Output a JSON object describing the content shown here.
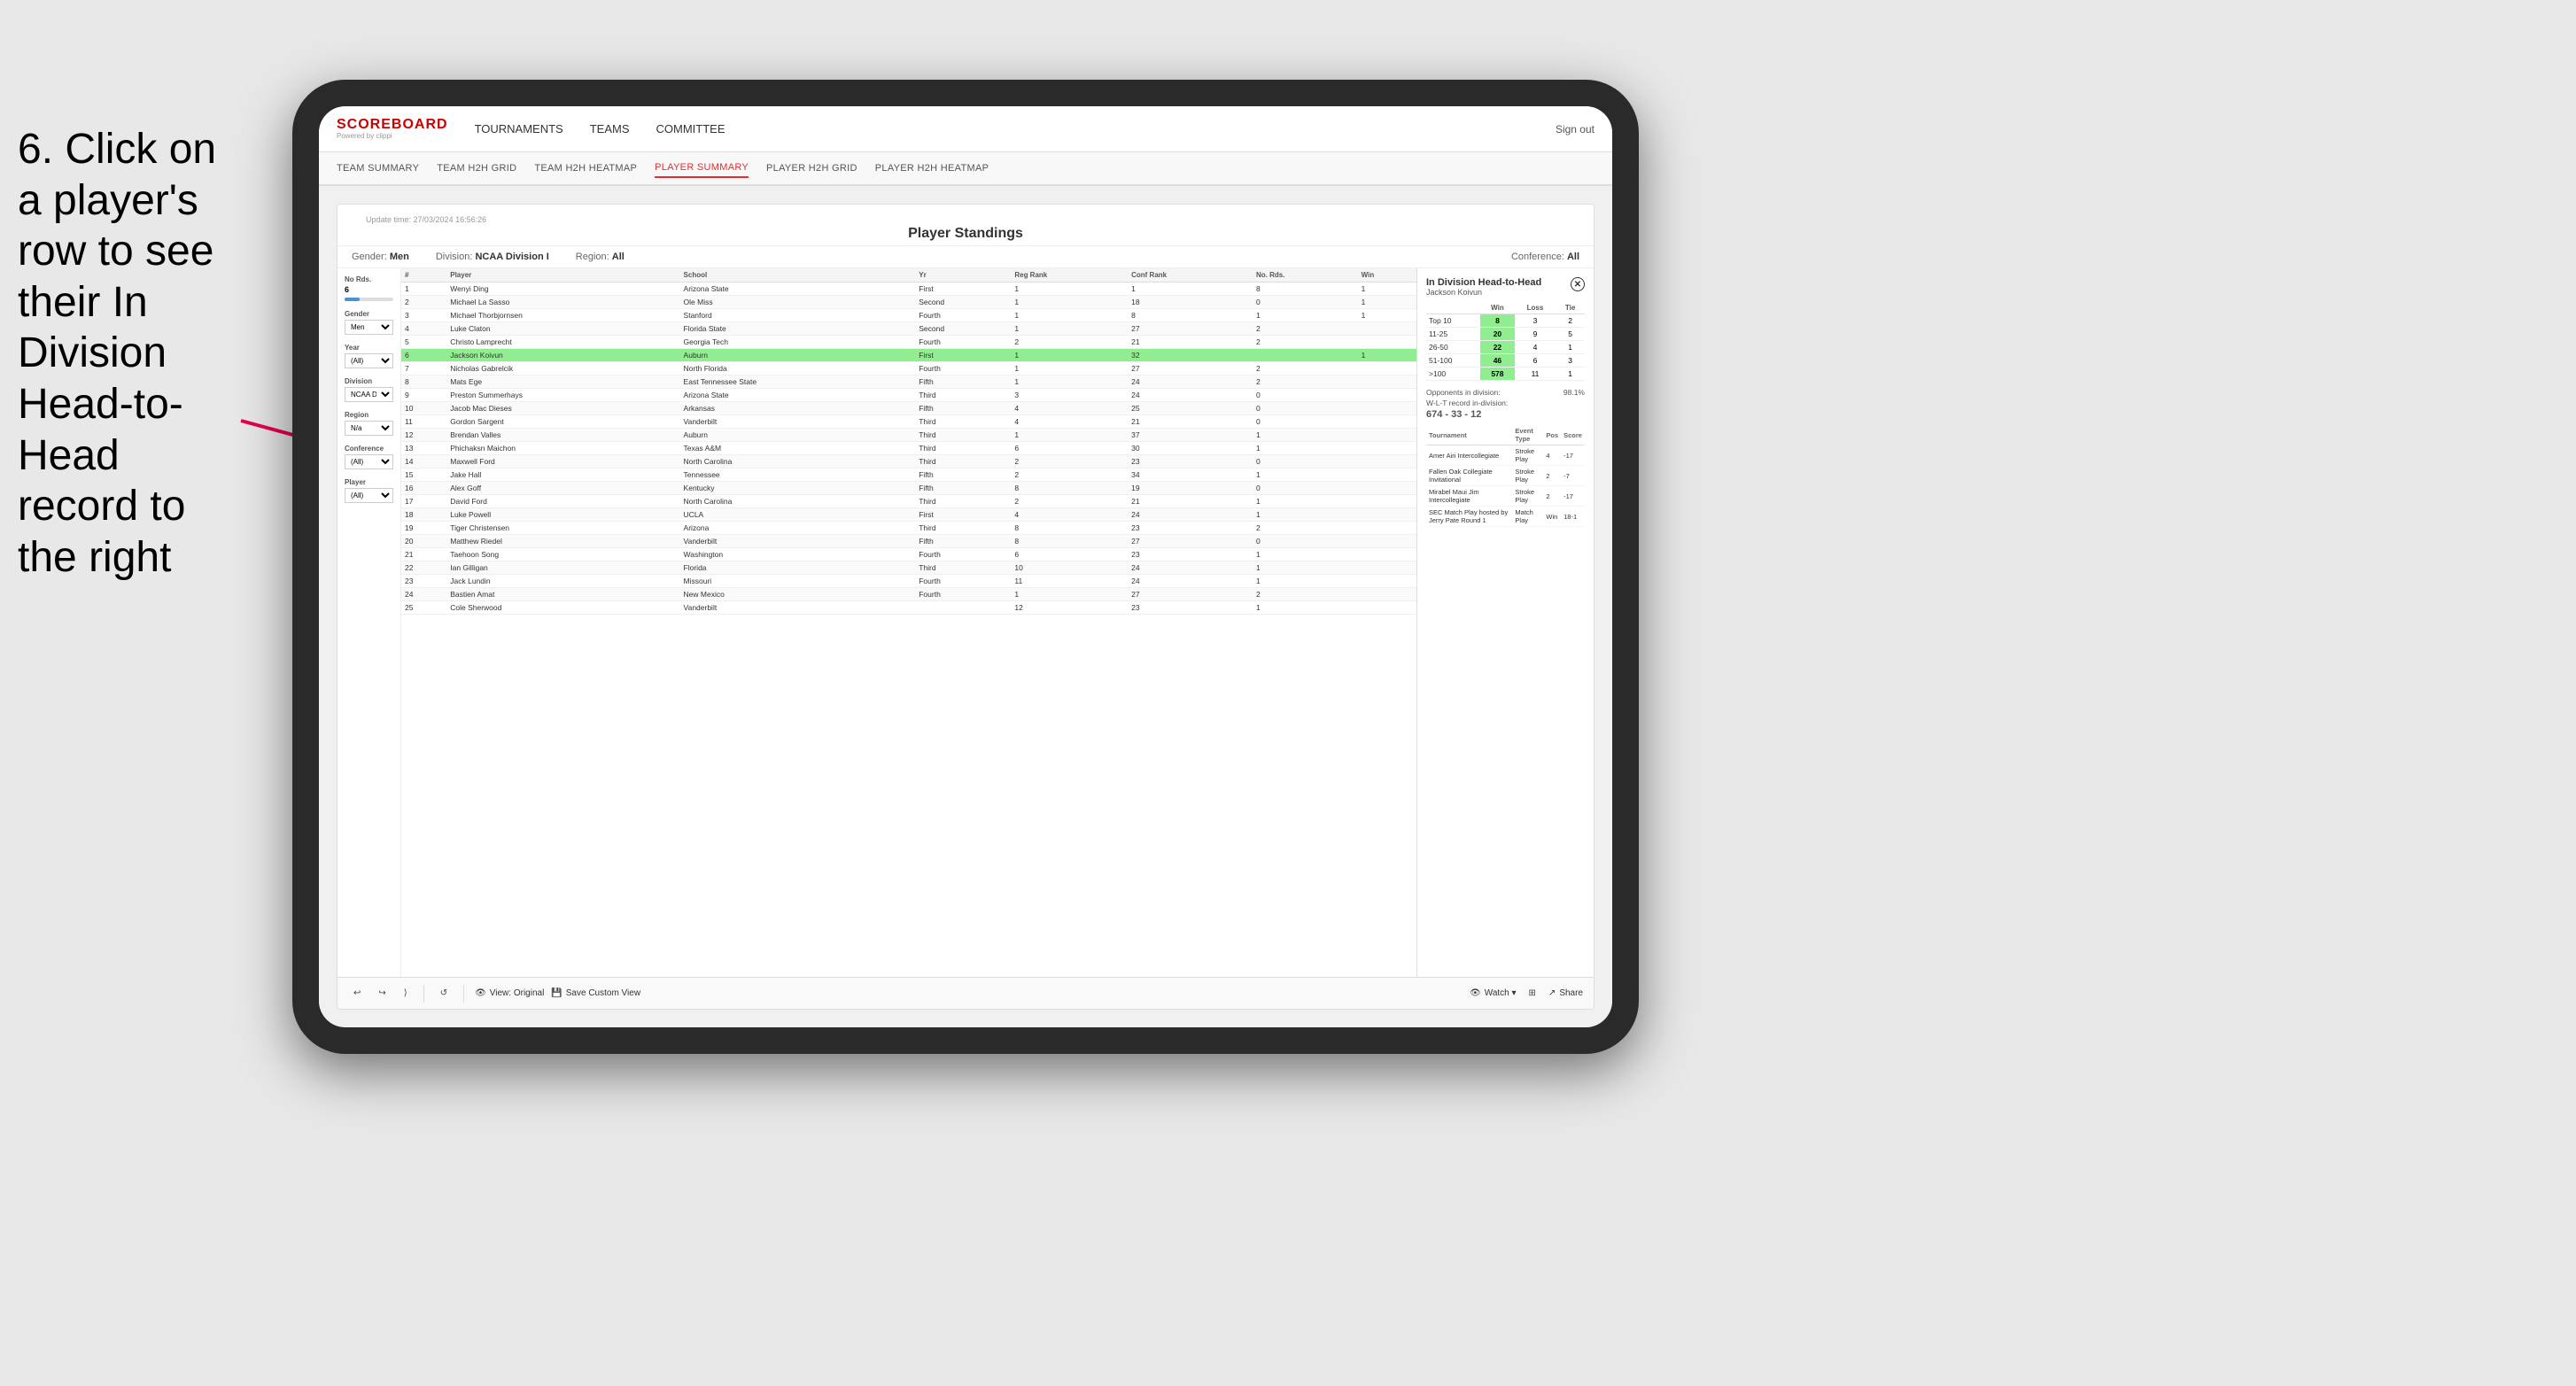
{
  "instruction": {
    "text": "6. Click on a player's row to see their In Division Head-to-Head record to the right"
  },
  "nav": {
    "logo": "SCOREBOARD",
    "powered_by": "Powered by clippi",
    "items": [
      "TOURNAMENTS",
      "TEAMS",
      "COMMITTEE"
    ],
    "sign_out": "Sign out"
  },
  "sub_nav": {
    "items": [
      "TEAM SUMMARY",
      "TEAM H2H GRID",
      "TEAM H2H HEATMAP",
      "PLAYER SUMMARY",
      "PLAYER H2H GRID",
      "PLAYER H2H HEATMAP"
    ],
    "active": "PLAYER SUMMARY"
  },
  "dashboard": {
    "update_time": "Update time: 27/03/2024 16:56:26",
    "title": "Player Standings",
    "filters": {
      "gender_label": "Gender:",
      "gender_value": "Men",
      "division_label": "Division:",
      "division_value": "NCAA Division I",
      "region_label": "Region:",
      "region_value": "All",
      "conference_label": "Conference:",
      "conference_value": "All"
    },
    "sidebar": {
      "no_rds_label": "No Rds.",
      "no_rds_value": "6",
      "gender_label": "Gender",
      "gender_value": "Men",
      "year_label": "Year",
      "year_value": "(All)",
      "division_label": "Division",
      "division_value": "NCAA Division I",
      "region_label": "Region",
      "region_value": "N/a",
      "conference_label": "Conference",
      "conference_value": "(All)",
      "player_label": "Player",
      "player_value": "(All)"
    },
    "table": {
      "columns": [
        "#",
        "Player",
        "School",
        "Yr",
        "Reg Rank",
        "Conf Rank",
        "No. Rds.",
        "Win"
      ],
      "rows": [
        {
          "num": "1",
          "player": "Wenyi Ding",
          "school": "Arizona State",
          "yr": "First",
          "reg_rank": "1",
          "conf_rank": "1",
          "no_rds": "8",
          "win": "1"
        },
        {
          "num": "2",
          "player": "Michael La Sasso",
          "school": "Ole Miss",
          "yr": "Second",
          "reg_rank": "1",
          "conf_rank": "18",
          "no_rds": "0",
          "win": "1"
        },
        {
          "num": "3",
          "player": "Michael Thorbjornsen",
          "school": "Stanford",
          "yr": "Fourth",
          "reg_rank": "1",
          "conf_rank": "8",
          "no_rds": "1",
          "win": "1"
        },
        {
          "num": "4",
          "player": "Luke Claton",
          "school": "Florida State",
          "yr": "Second",
          "reg_rank": "1",
          "conf_rank": "27",
          "no_rds": "2",
          "win": ""
        },
        {
          "num": "5",
          "player": "Christo Lamprecht",
          "school": "Georgia Tech",
          "yr": "Fourth",
          "reg_rank": "2",
          "conf_rank": "21",
          "no_rds": "2",
          "win": ""
        },
        {
          "num": "6",
          "player": "Jackson Koivun",
          "school": "Auburn",
          "yr": "First",
          "reg_rank": "1",
          "conf_rank": "32",
          "no_rds": "",
          "win": "1",
          "highlighted": true
        },
        {
          "num": "7",
          "player": "Nicholas Gabrelcik",
          "school": "North Florida",
          "yr": "Fourth",
          "reg_rank": "1",
          "conf_rank": "27",
          "no_rds": "2",
          "win": ""
        },
        {
          "num": "8",
          "player": "Mats Ege",
          "school": "East Tennessee State",
          "yr": "Fifth",
          "reg_rank": "1",
          "conf_rank": "24",
          "no_rds": "2",
          "win": ""
        },
        {
          "num": "9",
          "player": "Preston Summerhays",
          "school": "Arizona State",
          "yr": "Third",
          "reg_rank": "3",
          "conf_rank": "24",
          "no_rds": "0",
          "win": ""
        },
        {
          "num": "10",
          "player": "Jacob Mac Dieses",
          "school": "Arkansas",
          "yr": "Fifth",
          "reg_rank": "4",
          "conf_rank": "25",
          "no_rds": "0",
          "win": ""
        },
        {
          "num": "11",
          "player": "Gordon Sargent",
          "school": "Vanderbilt",
          "yr": "Third",
          "reg_rank": "4",
          "conf_rank": "21",
          "no_rds": "0",
          "win": ""
        },
        {
          "num": "12",
          "player": "Brendan Valles",
          "school": "Auburn",
          "yr": "Third",
          "reg_rank": "1",
          "conf_rank": "37",
          "no_rds": "1",
          "win": ""
        },
        {
          "num": "13",
          "player": "Phichaksn Maichon",
          "school": "Texas A&M",
          "yr": "Third",
          "reg_rank": "6",
          "conf_rank": "30",
          "no_rds": "1",
          "win": ""
        },
        {
          "num": "14",
          "player": "Maxwell Ford",
          "school": "North Carolina",
          "yr": "Third",
          "reg_rank": "2",
          "conf_rank": "23",
          "no_rds": "0",
          "win": ""
        },
        {
          "num": "15",
          "player": "Jake Hall",
          "school": "Tennessee",
          "yr": "Fifth",
          "reg_rank": "2",
          "conf_rank": "34",
          "no_rds": "1",
          "win": ""
        },
        {
          "num": "16",
          "player": "Alex Goff",
          "school": "Kentucky",
          "yr": "Fifth",
          "reg_rank": "8",
          "conf_rank": "19",
          "no_rds": "0",
          "win": ""
        },
        {
          "num": "17",
          "player": "David Ford",
          "school": "North Carolina",
          "yr": "Third",
          "reg_rank": "2",
          "conf_rank": "21",
          "no_rds": "1",
          "win": ""
        },
        {
          "num": "18",
          "player": "Luke Powell",
          "school": "UCLA",
          "yr": "First",
          "reg_rank": "4",
          "conf_rank": "24",
          "no_rds": "1",
          "win": ""
        },
        {
          "num": "19",
          "player": "Tiger Christensen",
          "school": "Arizona",
          "yr": "Third",
          "reg_rank": "8",
          "conf_rank": "23",
          "no_rds": "2",
          "win": ""
        },
        {
          "num": "20",
          "player": "Matthew Riedel",
          "school": "Vanderbilt",
          "yr": "Fifth",
          "reg_rank": "8",
          "conf_rank": "27",
          "no_rds": "0",
          "win": ""
        },
        {
          "num": "21",
          "player": "Taehoon Song",
          "school": "Washington",
          "yr": "Fourth",
          "reg_rank": "6",
          "conf_rank": "23",
          "no_rds": "1",
          "win": ""
        },
        {
          "num": "22",
          "player": "Ian Gilligan",
          "school": "Florida",
          "yr": "Third",
          "reg_rank": "10",
          "conf_rank": "24",
          "no_rds": "1",
          "win": ""
        },
        {
          "num": "23",
          "player": "Jack Lundin",
          "school": "Missouri",
          "yr": "Fourth",
          "reg_rank": "11",
          "conf_rank": "24",
          "no_rds": "1",
          "win": ""
        },
        {
          "num": "24",
          "player": "Bastien Amat",
          "school": "New Mexico",
          "yr": "Fourth",
          "reg_rank": "1",
          "conf_rank": "27",
          "no_rds": "2",
          "win": ""
        },
        {
          "num": "25",
          "player": "Cole Sherwood",
          "school": "Vanderbilt",
          "yr": "",
          "reg_rank": "12",
          "conf_rank": "23",
          "no_rds": "1",
          "win": ""
        }
      ]
    },
    "h2h_panel": {
      "title": "In Division Head-to-Head",
      "player": "Jackson Koivun",
      "table_headers": [
        "",
        "Win",
        "Loss",
        "Tie"
      ],
      "rows": [
        {
          "rank": "Top 10",
          "win": "8",
          "loss": "3",
          "tie": "2"
        },
        {
          "rank": "11-25",
          "win": "20",
          "loss": "9",
          "tie": "5"
        },
        {
          "rank": "26-50",
          "win": "22",
          "loss": "4",
          "tie": "1"
        },
        {
          "rank": "51-100",
          "win": "46",
          "loss": "6",
          "tie": "3"
        },
        {
          "rank": ">100",
          "win": "578",
          "loss": "11",
          "tie": "1"
        }
      ],
      "opponents_label": "Opponents in division:",
      "wlt_label": "W-L-T record in-division:",
      "opponents_value": "98.1%",
      "wlt_value": "674 - 33 - 12",
      "tournament_headers": [
        "Tournament",
        "Event Type",
        "Pos",
        "Score"
      ],
      "tournaments": [
        {
          "name": "Amer Airi Intercollegiate",
          "type": "Stroke Play",
          "pos": "4",
          "score": "-17"
        },
        {
          "name": "Fallen Oak Collegiate Invitational",
          "type": "Stroke Play",
          "pos": "2",
          "score": "-7"
        },
        {
          "name": "Mirabel Maui Jim Intercollegiate",
          "type": "Stroke Play",
          "pos": "2",
          "score": "-17"
        },
        {
          "name": "SEC Match Play hosted by Jerry Pate Round 1",
          "type": "Match Play",
          "pos": "Win",
          "score": "18-1"
        }
      ]
    },
    "toolbar": {
      "undo": "↩",
      "redo": "↪",
      "forward": "⟩",
      "back": "⟨",
      "view_original": "View: Original",
      "save_custom": "Save Custom View",
      "watch": "Watch ▾",
      "share": "Share"
    }
  }
}
